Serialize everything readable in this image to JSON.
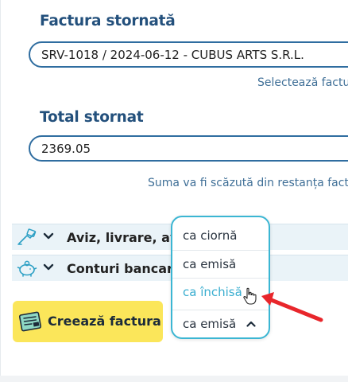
{
  "invoice": {
    "label": "Factura stornată",
    "value": "SRV-1018 / 2024-06-12 - CUBUS ARTS S.R.L.",
    "hint": "Selectează factu"
  },
  "total": {
    "label": "Total stornat",
    "value": "2369.05",
    "hint": "Suma va fi scăzută din restanța fact"
  },
  "sections": [
    {
      "label": "Aviz, livrare, ava",
      "icon": "delivery-icon"
    },
    {
      "label": "Conturi bancare",
      "icon": "piggy-bank-icon"
    }
  ],
  "create_button": {
    "label": "Creează factura",
    "icon": "invoice-document-icon"
  },
  "status_dropdown": {
    "options": [
      "ca ciornă",
      "ca emisă",
      "ca închisă"
    ],
    "highlighted": "ca închisă",
    "selected": "ca emisă"
  },
  "colors": {
    "label": "#23507c",
    "field_border": "#2f6da0",
    "section_bg": "#eaf3f8",
    "button_bg": "#fbe65a",
    "dropdown_border": "#3bb6d3",
    "highlight_text": "#3aaed0",
    "arrow": "#e8262b"
  }
}
